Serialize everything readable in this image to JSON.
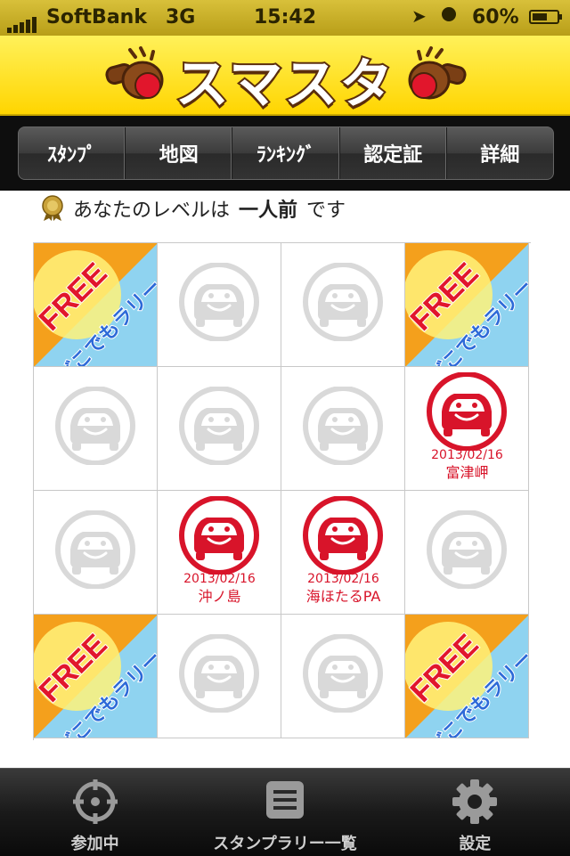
{
  "status_bar": {
    "carrier": "SoftBank",
    "network": "3G",
    "time": "15:42",
    "battery_percent_label": "60%",
    "battery_level": 0.6
  },
  "header": {
    "title": "スマスタ"
  },
  "tabs": [
    {
      "label": "ｽﾀﾝﾌﾟ"
    },
    {
      "label": "地図"
    },
    {
      "label": "ﾗﾝｷﾝｸﾞ"
    },
    {
      "label": "認定証"
    },
    {
      "label": "詳細"
    }
  ],
  "level": {
    "prefix": "あなたのレベルは",
    "value": "一人前",
    "suffix": "です"
  },
  "free_badge": {
    "free": "FREE",
    "subtitle": "どこでもラリー"
  },
  "grid": [
    {
      "type": "free"
    },
    {
      "type": "empty"
    },
    {
      "type": "empty"
    },
    {
      "type": "free"
    },
    {
      "type": "empty"
    },
    {
      "type": "empty"
    },
    {
      "type": "empty"
    },
    {
      "type": "stamped",
      "date": "2013/02/16",
      "place": "富津岬"
    },
    {
      "type": "empty"
    },
    {
      "type": "stamped",
      "date": "2013/02/16",
      "place": "沖ノ島"
    },
    {
      "type": "stamped",
      "date": "2013/02/16",
      "place": "海ほたるPA"
    },
    {
      "type": "empty"
    },
    {
      "type": "free"
    },
    {
      "type": "empty"
    },
    {
      "type": "empty"
    },
    {
      "type": "free"
    }
  ],
  "bottom_tabs": [
    {
      "label": "参加中",
      "icon": "crosshair-icon"
    },
    {
      "label": "スタンプラリー一覧",
      "icon": "list-icon"
    },
    {
      "label": "設定",
      "icon": "gear-icon"
    }
  ],
  "colors": {
    "header_yellow": "#ffe21a",
    "stamp_red": "#d8142a",
    "empty_gray": "#d9d9d9",
    "free_orange": "#f4a01c",
    "free_blue": "#8fd3f0"
  }
}
